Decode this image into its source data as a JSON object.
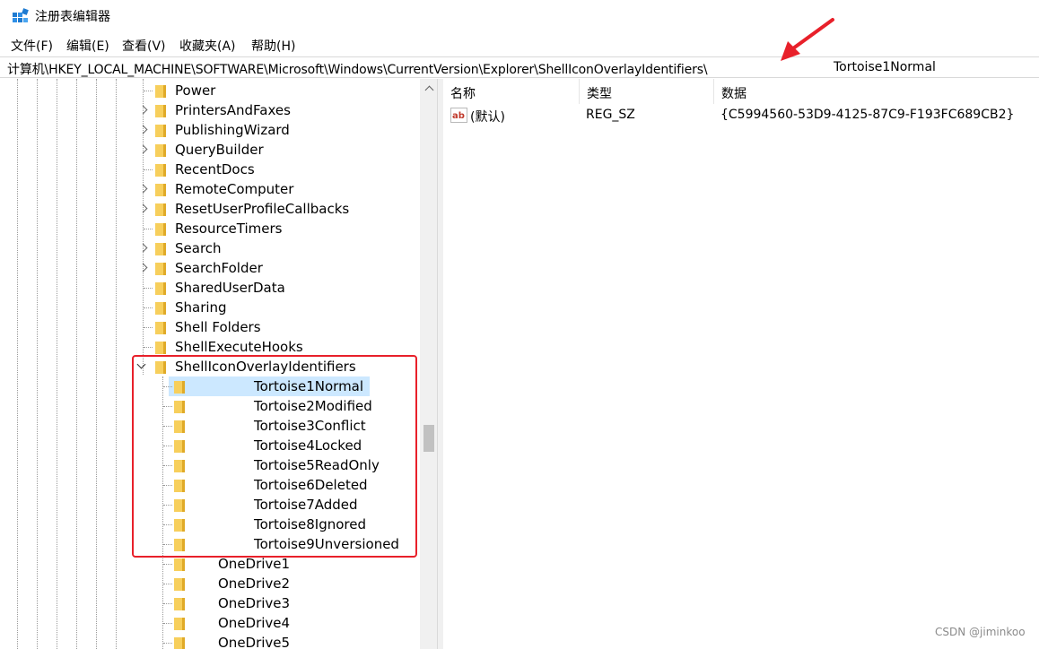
{
  "window": {
    "title": "注册表编辑器",
    "app_icon": "registry-editor-icon"
  },
  "menu": [
    "文件(F)",
    "编辑(E)",
    "查看(V)",
    "收藏夹(A)",
    "帮助(H)"
  ],
  "address": {
    "path": "计算机\\HKEY_LOCAL_MACHINE\\SOFTWARE\\Microsoft\\Windows\\CurrentVersion\\Explorer\\ShellIconOverlayIdentifiers\\",
    "key": "Tortoise1Normal"
  },
  "tree": {
    "items": [
      {
        "label": "Power",
        "expander": "none"
      },
      {
        "label": "PrintersAndFaxes",
        "expander": "collapsed"
      },
      {
        "label": "PublishingWizard",
        "expander": "collapsed"
      },
      {
        "label": "QueryBuilder",
        "expander": "collapsed"
      },
      {
        "label": "RecentDocs",
        "expander": "none"
      },
      {
        "label": "RemoteComputer",
        "expander": "collapsed"
      },
      {
        "label": "ResetUserProfileCallbacks",
        "expander": "collapsed"
      },
      {
        "label": "ResourceTimers",
        "expander": "none"
      },
      {
        "label": "Search",
        "expander": "collapsed"
      },
      {
        "label": "SearchFolder",
        "expander": "collapsed"
      },
      {
        "label": "SharedUserData",
        "expander": "none"
      },
      {
        "label": "Sharing",
        "expander": "none"
      },
      {
        "label": "Shell Folders",
        "expander": "none"
      },
      {
        "label": "ShellExecuteHooks",
        "expander": "none"
      },
      {
        "label": "ShellIconOverlayIdentifiers",
        "expander": "expanded"
      }
    ],
    "children": [
      {
        "label": "Tortoise1Normal",
        "selected": true
      },
      {
        "label": "Tortoise2Modified"
      },
      {
        "label": "Tortoise3Conflict"
      },
      {
        "label": "Tortoise4Locked"
      },
      {
        "label": "Tortoise5ReadOnly"
      },
      {
        "label": "Tortoise6Deleted"
      },
      {
        "label": "Tortoise7Added"
      },
      {
        "label": "Tortoise8Ignored"
      },
      {
        "label": "Tortoise9Unversioned"
      },
      {
        "label": "OneDrive1"
      },
      {
        "label": "OneDrive2"
      },
      {
        "label": "OneDrive3"
      },
      {
        "label": "OneDrive4"
      },
      {
        "label": "OneDrive5"
      }
    ]
  },
  "list": {
    "columns": [
      "名称",
      "类型",
      "数据"
    ],
    "rows": [
      {
        "icon": "string-value-icon",
        "name": "(默认)",
        "type": "REG_SZ",
        "data": "{C5994560-53D9-4125-87C9-F193FC689CB2}"
      }
    ]
  },
  "annotation_color": "#e8202a",
  "selection_color": "#cce8ff",
  "watermark": "CSDN @jiminkoo"
}
